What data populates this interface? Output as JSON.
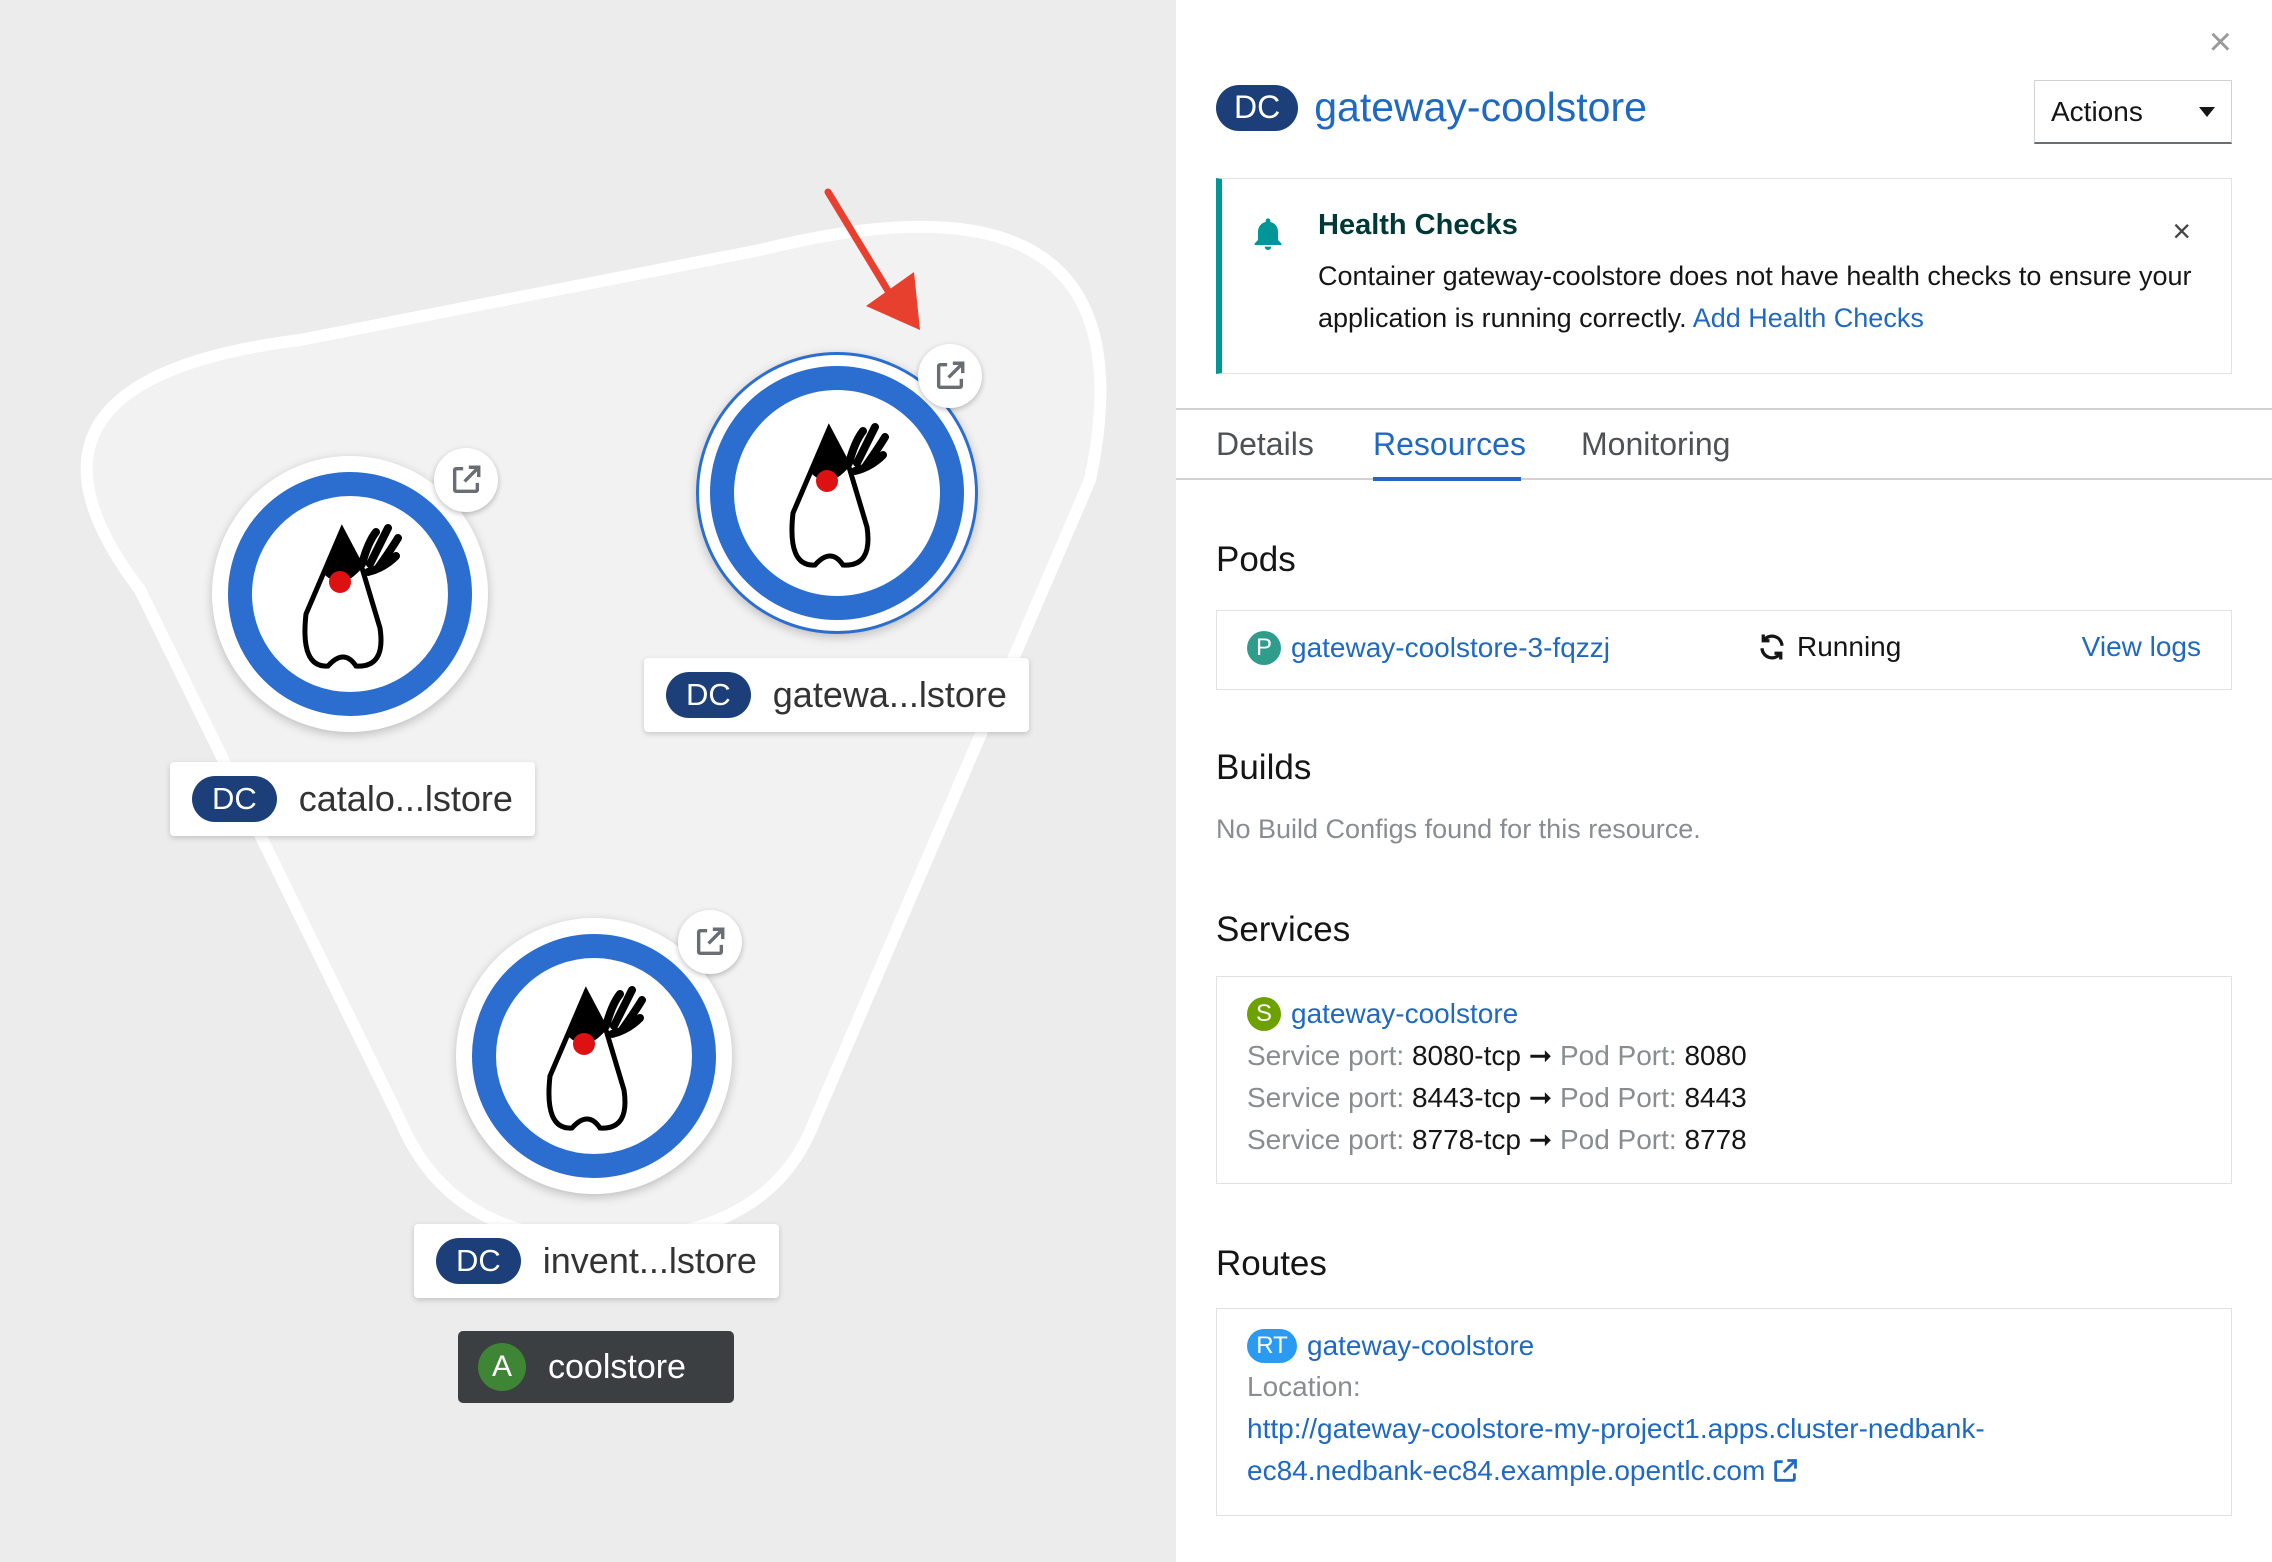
{
  "topology": {
    "nodes": [
      {
        "badge": "DC",
        "name": "catalo...lstore"
      },
      {
        "badge": "DC",
        "name": "gatewa...lstore"
      },
      {
        "badge": "DC",
        "name": "invent...lstore"
      }
    ],
    "application": {
      "badge": "A",
      "name": "coolstore"
    }
  },
  "panel": {
    "close_icon": "×",
    "badge": "DC",
    "title": "gateway-coolstore",
    "actions_label": "Actions",
    "alert": {
      "title": "Health Checks",
      "body": "Container gateway-coolstore does not have health checks to ensure your application is running correctly.",
      "link": "Add Health Checks",
      "close": "×"
    },
    "tabs": [
      "Details",
      "Resources",
      "Monitoring"
    ],
    "active_tab": "Resources",
    "pods": {
      "heading": "Pods",
      "badge": "P",
      "name": "gateway-coolstore-3-fqzzj",
      "status": "Running",
      "view_logs": "View logs"
    },
    "builds": {
      "heading": "Builds",
      "empty": "No Build Configs found for this resource."
    },
    "services": {
      "heading": "Services",
      "badge": "S",
      "name": "gateway-coolstore",
      "service_port_label": "Service port:",
      "pod_port_label": "Pod Port:",
      "arrow": "➞",
      "ports": [
        {
          "service": "8080-tcp",
          "pod": "8080"
        },
        {
          "service": "8443-tcp",
          "pod": "8443"
        },
        {
          "service": "8778-tcp",
          "pod": "8778"
        }
      ]
    },
    "routes": {
      "heading": "Routes",
      "badge": "RT",
      "name": "gateway-coolstore",
      "location_label": "Location:",
      "url_line1": "http://gateway-coolstore-my-project1.apps.cluster-nedbank-",
      "url_line2": "ec84.nedbank-ec84.example.opentlc.com"
    }
  },
  "colors": {
    "accent": "#2b6ed0",
    "link": "#1f69c1",
    "dc_badge": "#1c3f7a",
    "app_badge": "#3e8635",
    "alert_border": "#009596",
    "annotation_arrow": "#e8402e"
  }
}
